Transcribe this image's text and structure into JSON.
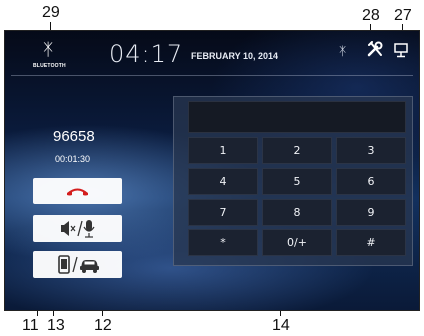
{
  "callouts": {
    "c29": "29",
    "c28": "28",
    "c27": "27",
    "c11": "11",
    "c13": "13",
    "c12": "12",
    "c14": "14"
  },
  "status_bar": {
    "bluetooth_label": "BLUETOOTH",
    "time": "04:17",
    "date": "FEBRUARY 10, 2014"
  },
  "call": {
    "number": "96658",
    "duration": "00:01:30"
  },
  "keypad": {
    "keys": [
      "1",
      "2",
      "3",
      "4",
      "5",
      "6",
      "7",
      "8",
      "9",
      "*",
      "0/+",
      "#"
    ]
  },
  "colors": {
    "hangup_red": "#d41e1e"
  },
  "icons": {
    "bluetooth": "bluetooth-icon",
    "settings": "settings-icon",
    "display": "display-icon",
    "hangup": "phone-hangup-icon",
    "mute": "speaker-mute-icon",
    "mic": "microphone-icon",
    "handset": "handset-icon",
    "car": "car-icon"
  }
}
